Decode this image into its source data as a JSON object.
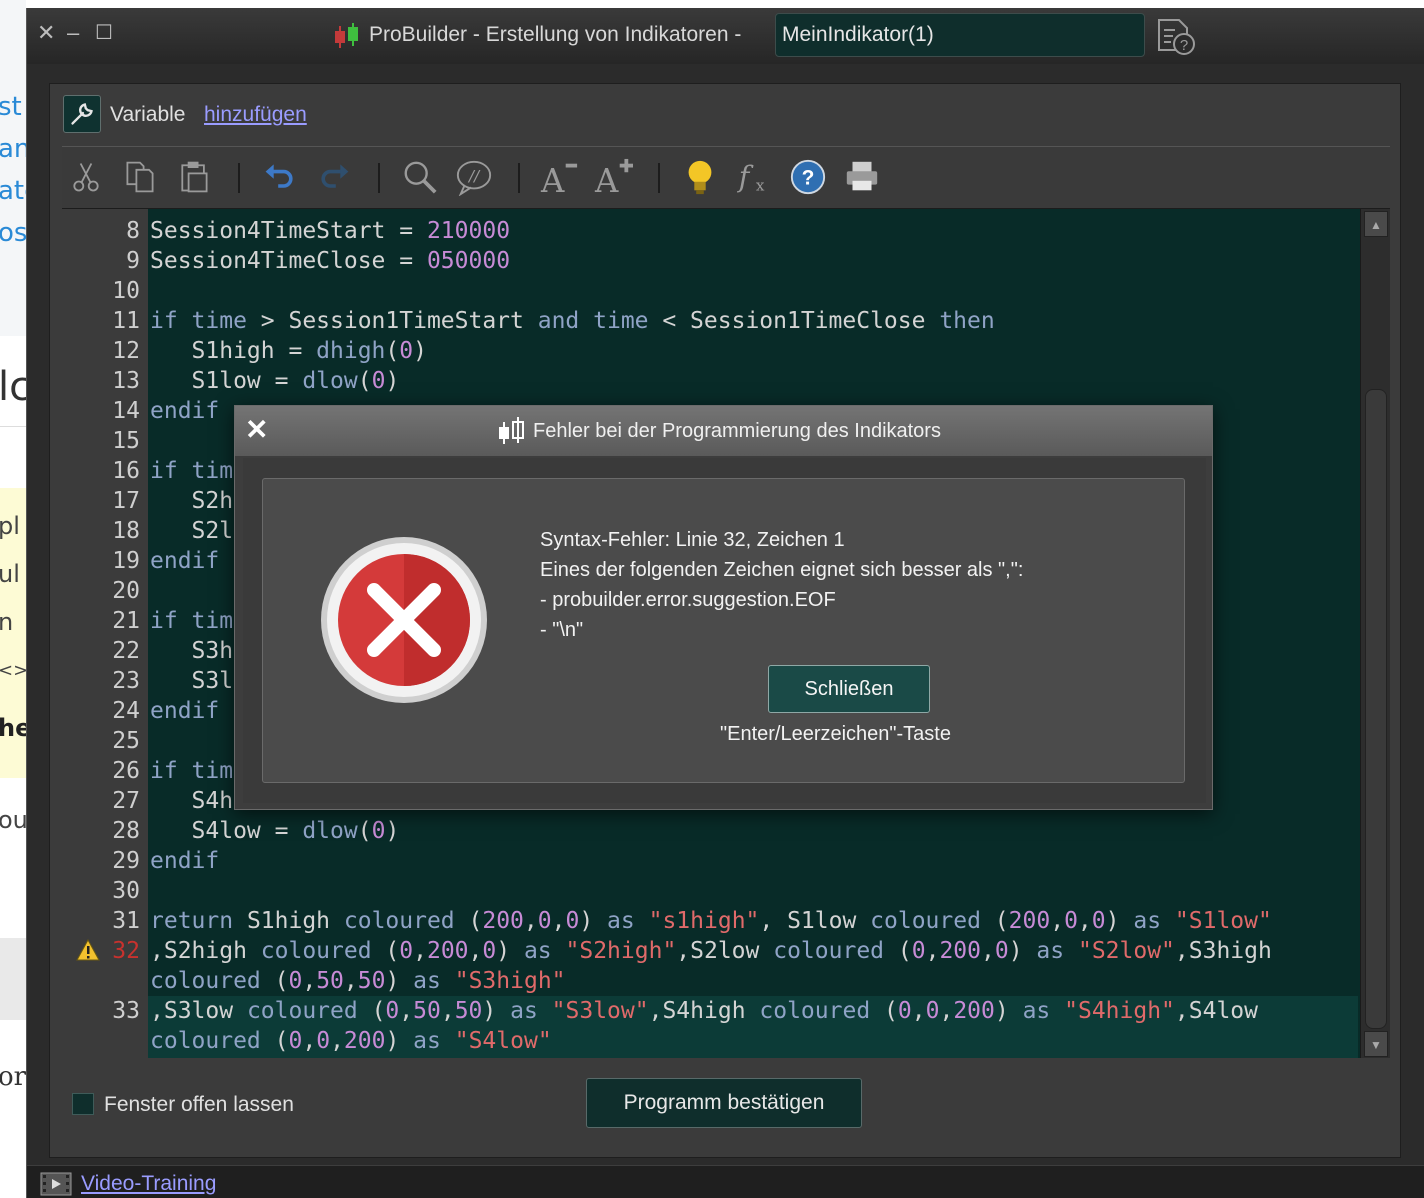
{
  "background_page": {
    "fragments": [
      "st y",
      "an",
      "ate",
      "os",
      "lc",
      "pl",
      "ul",
      "n",
      "<>",
      "he",
      "ou",
      "or"
    ]
  },
  "window": {
    "title": "ProBuilder -  Erstellung von Indikatoren  -",
    "indicator_name": "MeinIndikator(1)",
    "controls": {
      "close": "✕",
      "minimize": "–",
      "maximize": "☐"
    }
  },
  "variable_bar": {
    "label": "Variable",
    "add_link": "hinzufügen"
  },
  "toolbar": {
    "icons": [
      "scissors-icon",
      "copy-icon",
      "paste-icon",
      "undo-icon",
      "redo-icon",
      "search-icon",
      "comment-icon",
      "font-decrease-icon",
      "font-increase-icon",
      "lightbulb-icon",
      "function-icon",
      "help-icon",
      "print-icon"
    ]
  },
  "editor": {
    "lines": [
      {
        "n": "8",
        "code": [
          {
            "t": "Session4TimeStart = "
          },
          {
            "t": "210000",
            "c": "num"
          }
        ]
      },
      {
        "n": "9",
        "code": [
          {
            "t": "Session4TimeClose = "
          },
          {
            "t": "050000",
            "c": "num"
          }
        ]
      },
      {
        "n": "10",
        "code": []
      },
      {
        "n": "11",
        "code": [
          {
            "t": "if time",
            "c": "kw"
          },
          {
            "t": " > Session1TimeStart "
          },
          {
            "t": "and time",
            "c": "kw"
          },
          {
            "t": " < Session1TimeClose "
          },
          {
            "t": "then",
            "c": "kw"
          }
        ]
      },
      {
        "n": "12",
        "code": [
          {
            "t": "   S1high = "
          },
          {
            "t": "dhigh",
            "c": "kw"
          },
          {
            "t": "("
          },
          {
            "t": "0",
            "c": "num"
          },
          {
            "t": ")"
          }
        ]
      },
      {
        "n": "13",
        "code": [
          {
            "t": "   S1low = "
          },
          {
            "t": "dlow",
            "c": "kw"
          },
          {
            "t": "("
          },
          {
            "t": "0",
            "c": "num"
          },
          {
            "t": ")"
          }
        ]
      },
      {
        "n": "14",
        "code": [
          {
            "t": "endif",
            "c": "kw"
          }
        ]
      },
      {
        "n": "15",
        "code": []
      },
      {
        "n": "16",
        "code": [
          {
            "t": "if tim",
            "c": "kw"
          }
        ]
      },
      {
        "n": "17",
        "code": [
          {
            "t": "   S2h"
          }
        ]
      },
      {
        "n": "18",
        "code": [
          {
            "t": "   S2l"
          }
        ]
      },
      {
        "n": "19",
        "code": [
          {
            "t": "endif",
            "c": "kw"
          }
        ]
      },
      {
        "n": "20",
        "code": []
      },
      {
        "n": "21",
        "code": [
          {
            "t": "if tim",
            "c": "kw"
          }
        ]
      },
      {
        "n": "22",
        "code": [
          {
            "t": "   S3h"
          }
        ]
      },
      {
        "n": "23",
        "code": [
          {
            "t": "   S3l"
          }
        ]
      },
      {
        "n": "24",
        "code": [
          {
            "t": "endif",
            "c": "kw"
          }
        ]
      },
      {
        "n": "25",
        "code": []
      },
      {
        "n": "26",
        "code": [
          {
            "t": "if tim",
            "c": "kw"
          }
        ]
      },
      {
        "n": "27",
        "code": [
          {
            "t": "   S4h"
          }
        ]
      },
      {
        "n": "28",
        "code": [
          {
            "t": "   S4low = "
          },
          {
            "t": "dlow",
            "c": "kw"
          },
          {
            "t": "("
          },
          {
            "t": "0",
            "c": "num"
          },
          {
            "t": ")"
          }
        ]
      },
      {
        "n": "29",
        "code": [
          {
            "t": "endif",
            "c": "kw"
          }
        ]
      },
      {
        "n": "30",
        "code": []
      },
      {
        "n": "31",
        "code": [
          {
            "t": "return",
            "c": "kw"
          },
          {
            "t": " S1high "
          },
          {
            "t": "coloured",
            "c": "kw"
          },
          {
            "t": " ("
          },
          {
            "t": "200",
            "c": "num"
          },
          {
            "t": ","
          },
          {
            "t": "0",
            "c": "num"
          },
          {
            "t": ","
          },
          {
            "t": "0",
            "c": "num"
          },
          {
            "t": ") "
          },
          {
            "t": "as",
            "c": "kw"
          },
          {
            "t": " "
          },
          {
            "t": "\"s1high\"",
            "c": "str"
          },
          {
            "t": ", S1low "
          },
          {
            "t": "coloured",
            "c": "kw"
          },
          {
            "t": " ("
          },
          {
            "t": "200",
            "c": "num"
          },
          {
            "t": ","
          },
          {
            "t": "0",
            "c": "num"
          },
          {
            "t": ","
          },
          {
            "t": "0",
            "c": "num"
          },
          {
            "t": ") "
          },
          {
            "t": "as",
            "c": "kw"
          },
          {
            "t": " "
          },
          {
            "t": "\"S1low\"",
            "c": "str"
          }
        ]
      },
      {
        "n": "32",
        "err": true,
        "code": [
          {
            "t": ",S2high "
          },
          {
            "t": "coloured",
            "c": "kw"
          },
          {
            "t": " ("
          },
          {
            "t": "0",
            "c": "num"
          },
          {
            "t": ","
          },
          {
            "t": "200",
            "c": "num"
          },
          {
            "t": ","
          },
          {
            "t": "0",
            "c": "num"
          },
          {
            "t": ") "
          },
          {
            "t": "as",
            "c": "kw"
          },
          {
            "t": " "
          },
          {
            "t": "\"S2high\"",
            "c": "str"
          },
          {
            "t": ",S2low "
          },
          {
            "t": "coloured",
            "c": "kw"
          },
          {
            "t": " ("
          },
          {
            "t": "0",
            "c": "num"
          },
          {
            "t": ","
          },
          {
            "t": "200",
            "c": "num"
          },
          {
            "t": ","
          },
          {
            "t": "0",
            "c": "num"
          },
          {
            "t": ") "
          },
          {
            "t": "as",
            "c": "kw"
          },
          {
            "t": " "
          },
          {
            "t": "\"S2low\"",
            "c": "str"
          },
          {
            "t": ",S3high"
          }
        ]
      },
      {
        "n": "",
        "code": [
          {
            "t": "coloured",
            "c": "kw"
          },
          {
            "t": " ("
          },
          {
            "t": "0",
            "c": "num"
          },
          {
            "t": ","
          },
          {
            "t": "50",
            "c": "num"
          },
          {
            "t": ","
          },
          {
            "t": "50",
            "c": "num"
          },
          {
            "t": ") "
          },
          {
            "t": "as",
            "c": "kw"
          },
          {
            "t": " "
          },
          {
            "t": "\"S3high\"",
            "c": "str"
          }
        ]
      },
      {
        "n": "33",
        "code": [
          {
            "t": ",S3low "
          },
          {
            "t": "coloured",
            "c": "kw"
          },
          {
            "t": " ("
          },
          {
            "t": "0",
            "c": "num"
          },
          {
            "t": ","
          },
          {
            "t": "50",
            "c": "num"
          },
          {
            "t": ","
          },
          {
            "t": "50",
            "c": "num"
          },
          {
            "t": ") "
          },
          {
            "t": "as",
            "c": "kw"
          },
          {
            "t": " "
          },
          {
            "t": "\"S3low\"",
            "c": "str"
          },
          {
            "t": ",S4high "
          },
          {
            "t": "coloured",
            "c": "kw"
          },
          {
            "t": " ("
          },
          {
            "t": "0",
            "c": "num"
          },
          {
            "t": ","
          },
          {
            "t": "0",
            "c": "num"
          },
          {
            "t": ","
          },
          {
            "t": "200",
            "c": "num"
          },
          {
            "t": ") "
          },
          {
            "t": "as",
            "c": "kw"
          },
          {
            "t": " "
          },
          {
            "t": "\"S4high\"",
            "c": "str"
          },
          {
            "t": ",S4low"
          }
        ]
      },
      {
        "n": "",
        "code": [
          {
            "t": "coloured",
            "c": "kw"
          },
          {
            "t": " ("
          },
          {
            "t": "0",
            "c": "num"
          },
          {
            "t": ","
          },
          {
            "t": "0",
            "c": "num"
          },
          {
            "t": ","
          },
          {
            "t": "200",
            "c": "num"
          },
          {
            "t": ") "
          },
          {
            "t": "as",
            "c": "kw"
          },
          {
            "t": " "
          },
          {
            "t": "\"S4low\"",
            "c": "str"
          }
        ]
      }
    ]
  },
  "footer_controls": {
    "keep_open_label": "Fenster offen lassen",
    "keep_open_checked": false,
    "confirm_label": "Programm bestätigen"
  },
  "footer": {
    "video_link": "Video-Training"
  },
  "dialog": {
    "title": "Fehler bei der Programmierung des Indikators",
    "close_glyph": "✕",
    "message_lines": [
      "Syntax-Fehler: Linie 32, Zeichen 1",
      "Eines der folgenden Zeichen eignet sich besser als \",\":",
      "- probuilder.error.suggestion.EOF",
      "- \"\\n\""
    ],
    "close_button": "Schließen",
    "key_hint": "\"Enter/Leerzeichen\"-Taste"
  },
  "colors": {
    "editor_bg": "#082b28",
    "keyword": "#8fa3c6",
    "number": "#c78bd6",
    "string": "#e06a6a",
    "error_line_number": "#c8322e",
    "link": "#9a9cff"
  }
}
